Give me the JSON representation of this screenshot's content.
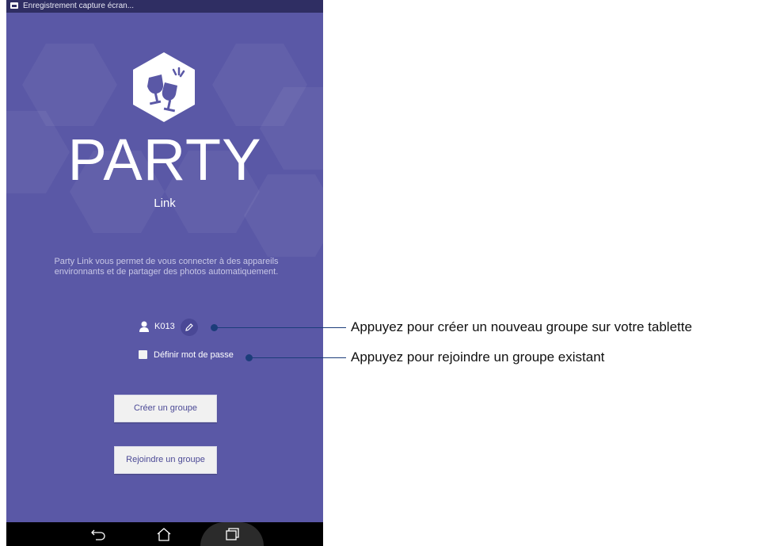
{
  "status_bar": {
    "notification": "Enregistrement capture écran..."
  },
  "app": {
    "title": "PARTY",
    "subtitle": "Link",
    "description": "Party Link vous permet de vous connecter à des appareils environnants et de partager des photos automatiquement.",
    "device_name": "K013",
    "password_label": "Définir mot de passe",
    "password_checked": false,
    "create_button": "Créer un groupe",
    "join_button": "Rejoindre un groupe",
    "background_color": "#5a58a6",
    "accent_color": "#4c4a96"
  },
  "nav_bar": {
    "icons": [
      "back-icon",
      "home-icon",
      "recent-apps-icon"
    ]
  },
  "callouts": [
    {
      "text": "Appuyez pour créer un nouveau groupe sur votre tablette"
    },
    {
      "text": "Appuyez pour rejoindre un groupe existant"
    }
  ]
}
